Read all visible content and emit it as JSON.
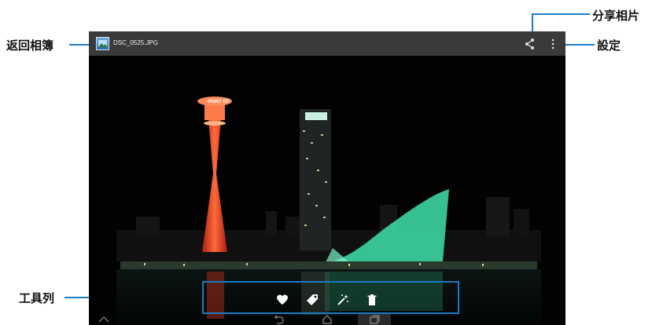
{
  "callouts": {
    "back_to_album": "返回相簿",
    "share_photo": "分享相片",
    "settings": "設定",
    "toolbar": "工具列"
  },
  "action_bar": {
    "file_name": "DSC_0525.JPG",
    "share_icon": "share-icon",
    "menu_icon": "overflow-menu-icon"
  },
  "photo": {
    "subject": "night harbor cityscape",
    "tower_sign": "-PORT OF"
  },
  "toolbar": {
    "buttons": [
      "favorite-heart-icon",
      "tag-icon",
      "magic-wand-icon",
      "delete-trash-icon"
    ]
  },
  "system_bar": {
    "buttons": [
      "hide-bar-icon",
      "back-icon",
      "home-icon",
      "recent-apps-icon"
    ]
  },
  "colors": {
    "accent": "#1c7bc4",
    "action_bar": "#3a3a3a",
    "tower": "#e0432a",
    "museum": "#3fe0a8"
  }
}
